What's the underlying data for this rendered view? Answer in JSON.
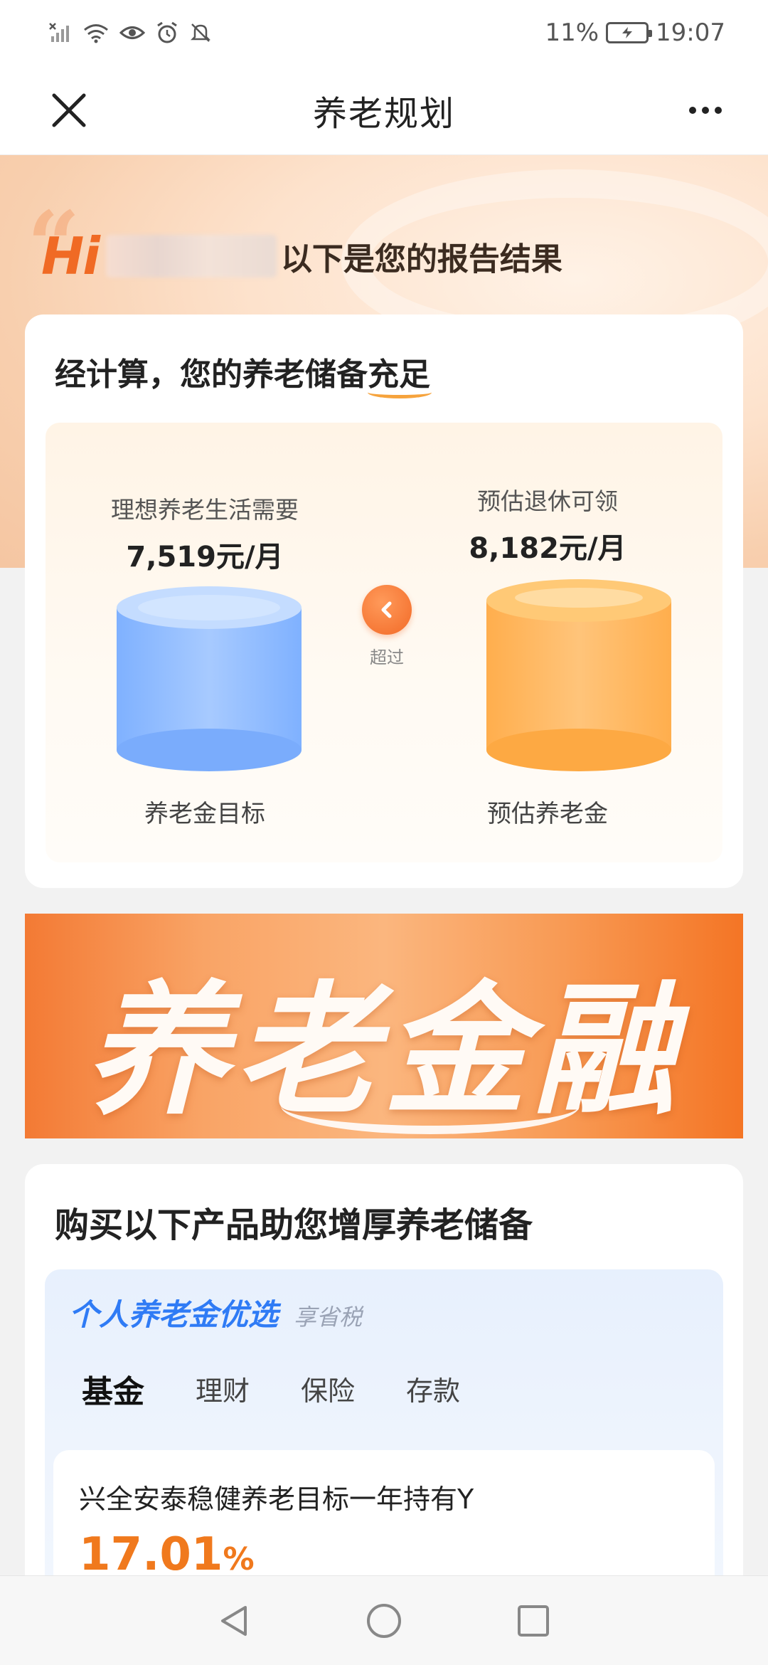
{
  "status_bar": {
    "battery_percent": "11%",
    "time": "19:07",
    "icons": [
      "no-sim-signal-icon",
      "wifi-icon",
      "eye-icon",
      "alarm-icon",
      "mute-icon",
      "battery-charging-icon"
    ]
  },
  "nav": {
    "title": "养老规划",
    "close_icon": "close-icon",
    "more_icon": "more-icon"
  },
  "hero": {
    "greeting_hi": "Hi",
    "greeting_text": "以下是您的报告结果"
  },
  "result": {
    "title_prefix": "经计算，您的养老储备",
    "title_highlight": "充足",
    "left": {
      "label": "理想养老生活需要",
      "value": "7,519元/月",
      "bottom": "养老金目标"
    },
    "right": {
      "label": "预估退休可领",
      "value": "8,182元/月",
      "bottom": "预估养老金"
    },
    "exceed_label": "超过",
    "colors": {
      "left_cylinder": "#8ebcff",
      "right_cylinder": "#ffb55c",
      "accent": "#f26a27"
    }
  },
  "banner": {
    "text": "养老金融"
  },
  "products": {
    "title": "购买以下产品助您增厚养老储备",
    "panel_name": "个人养老金优选",
    "panel_tag": "享省税",
    "tabs": [
      "基金",
      "理财",
      "保险",
      "存款"
    ],
    "active_tab": "基金",
    "fund": {
      "name": "兴全安泰稳健养老目标一年持有Y",
      "rate": "17.01",
      "rate_unit": "%"
    }
  },
  "system_nav": {
    "icons": [
      "back-icon",
      "home-icon",
      "recents-icon"
    ]
  }
}
